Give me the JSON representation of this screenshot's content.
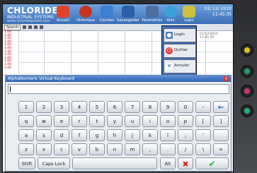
{
  "app": {
    "brand": "CHLORIDE",
    "brand_sub": "INDUSTRIAL SYSTEMS",
    "brand_url": "www.chloridepower.com"
  },
  "nav": [
    {
      "label": "Accueil",
      "icon": "home-icon",
      "color": "#e0452c"
    },
    {
      "label": "Historique",
      "icon": "history-icon",
      "color": "#c8331f"
    },
    {
      "label": "Courbes",
      "icon": "chart-icon",
      "color": "#3a7fd0"
    },
    {
      "label": "Sauvegarder",
      "icon": "save-icon",
      "color": "#2b5fa8"
    },
    {
      "label": "Paramètres",
      "icon": "settings-icon",
      "color": "#4c6ea0"
    },
    {
      "label": "Aide",
      "icon": "help-icon",
      "color": "#3aa0d8"
    },
    {
      "label": "Login",
      "icon": "login-icon",
      "color": "#d0c040"
    }
  ],
  "status": {
    "date": "02/ 12/ 2010",
    "time": "11:45:35"
  },
  "toolbar": {
    "search": "Search"
  },
  "chart": {
    "y_labels": [
      "1.00",
      "1.00",
      "1.00",
      "1.00",
      "1.00",
      "1.00",
      "1.00",
      "1.00",
      "1.00",
      "1.00",
      "1.00",
      "1.00"
    ],
    "date_label": "01/12/2010 11:45:35"
  },
  "popup_menu": [
    {
      "label": "Login",
      "icon": "user-icon",
      "color": "#4a7cc0"
    },
    {
      "label": "Quitter",
      "icon": "power-icon",
      "color": "#d33"
    },
    {
      "label": "Annuler",
      "icon": "cancel-icon",
      "color": "#3355aa"
    }
  ],
  "keyboard": {
    "title": "AlphaNumeric Virtual Keyboard",
    "input_value": "",
    "rows": [
      [
        "1",
        "2",
        "3",
        "4",
        "5",
        "6",
        "7",
        "8",
        "9",
        "0",
        "-",
        "←"
      ],
      [
        "q",
        "w",
        "e",
        "r",
        "t",
        "y",
        "u",
        "i",
        "o",
        "p",
        "[",
        "]"
      ],
      [
        "a",
        "s",
        "d",
        "f",
        "g",
        "h",
        "j",
        "k",
        "l",
        ";",
        "'",
        ""
      ],
      [
        "z",
        "x",
        "c",
        "v",
        "b",
        "n",
        "m",
        ",",
        ".",
        "/",
        "\\",
        "="
      ]
    ],
    "shift": "Shift",
    "caps": "Caps Lock",
    "alt": "Alt",
    "cancel": "✖",
    "ok": "✔",
    "colors": {
      "cancel": "#dd2222",
      "ok": "#1aa84a",
      "backspace": "#2255aa"
    }
  },
  "side_buttons": [
    {
      "icon": "alarm-icon",
      "color": "#e0c020"
    },
    {
      "icon": "power-icon",
      "color": "#1aa06a"
    },
    {
      "icon": "stop-icon",
      "color": "#c8356a"
    },
    {
      "icon": "run-icon",
      "color": "#1ab07a"
    }
  ]
}
